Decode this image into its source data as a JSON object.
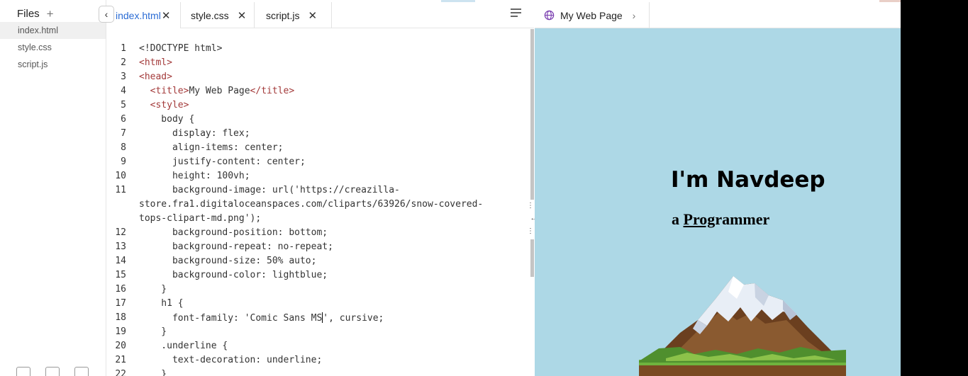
{
  "sidebar": {
    "title": "Files",
    "items": [
      "index.html",
      "style.css",
      "script.js"
    ]
  },
  "tabs": [
    {
      "label": "index.html",
      "active": true
    },
    {
      "label": "style.css",
      "active": false
    },
    {
      "label": "script.js",
      "active": false
    }
  ],
  "editor": {
    "lines": [
      {
        "n": "1",
        "parts": [
          [
            "",
            "<!DOCTYPE html>"
          ]
        ]
      },
      {
        "n": "2",
        "parts": [
          [
            "tg",
            "<html>"
          ]
        ]
      },
      {
        "n": "3",
        "parts": [
          [
            "tg",
            "<head>"
          ]
        ]
      },
      {
        "n": "4",
        "parts": [
          [
            "",
            "  "
          ],
          [
            "tg",
            "<title>"
          ],
          [
            "",
            "My Web Page"
          ],
          [
            "tg",
            "</title>"
          ]
        ]
      },
      {
        "n": "5",
        "parts": [
          [
            "",
            "  "
          ],
          [
            "tg",
            "<style>"
          ]
        ]
      },
      {
        "n": "6",
        "parts": [
          [
            "",
            "    body {"
          ]
        ]
      },
      {
        "n": "7",
        "parts": [
          [
            "",
            "      display: flex;"
          ]
        ]
      },
      {
        "n": "8",
        "parts": [
          [
            "",
            "      align-items: center;"
          ]
        ]
      },
      {
        "n": "9",
        "parts": [
          [
            "",
            "      justify-content: center;"
          ]
        ]
      },
      {
        "n": "10",
        "parts": [
          [
            "",
            "      height: 100vh;"
          ]
        ]
      },
      {
        "n": "11",
        "parts": [
          [
            "",
            "      background-image: url('https://creazilla-"
          ]
        ]
      },
      {
        "n": "",
        "parts": [
          [
            "",
            "store.fra1.digitaloceanspaces.com/cliparts/63926/snow-covered-"
          ]
        ]
      },
      {
        "n": "",
        "parts": [
          [
            "",
            "tops-clipart-md.png');"
          ]
        ]
      },
      {
        "n": "12",
        "parts": [
          [
            "",
            "      background-position: bottom;"
          ]
        ]
      },
      {
        "n": "13",
        "parts": [
          [
            "",
            "      background-repeat: no-repeat;"
          ]
        ]
      },
      {
        "n": "14",
        "parts": [
          [
            "",
            "      background-size: 50% auto;"
          ]
        ]
      },
      {
        "n": "15",
        "parts": [
          [
            "",
            "      background-color: lightblue;"
          ]
        ]
      },
      {
        "n": "16",
        "parts": [
          [
            "",
            "    }"
          ]
        ]
      },
      {
        "n": "17",
        "parts": [
          [
            "",
            "    h1 {"
          ]
        ]
      },
      {
        "n": "18",
        "parts": [
          [
            "",
            "      font-family: 'Comic Sans MS"
          ],
          [
            "caret",
            ""
          ],
          [
            "",
            "', cursive;"
          ]
        ]
      },
      {
        "n": "19",
        "parts": [
          [
            "",
            "    }"
          ]
        ]
      },
      {
        "n": "20",
        "parts": [
          [
            "",
            "    .underline {"
          ]
        ]
      },
      {
        "n": "21",
        "parts": [
          [
            "",
            "      text-decoration: underline;"
          ]
        ]
      },
      {
        "n": "22",
        "parts": [
          [
            "",
            "    }"
          ]
        ]
      }
    ]
  },
  "preview": {
    "tab_title": "My Web Page",
    "heading": "I'm Navdeep",
    "subheading_prefix": "a ",
    "subheading_underlined": "Prog",
    "subheading_rest": "rammer",
    "background_color": "#add8e6"
  },
  "icons": {
    "add_file": "plus-icon",
    "back": "chevron-left-icon",
    "close": "close-icon",
    "menu": "menu-lines-icon",
    "globe": "globe-icon",
    "forward": "chevron-right-icon",
    "splitter": "drag-handle-icon"
  }
}
